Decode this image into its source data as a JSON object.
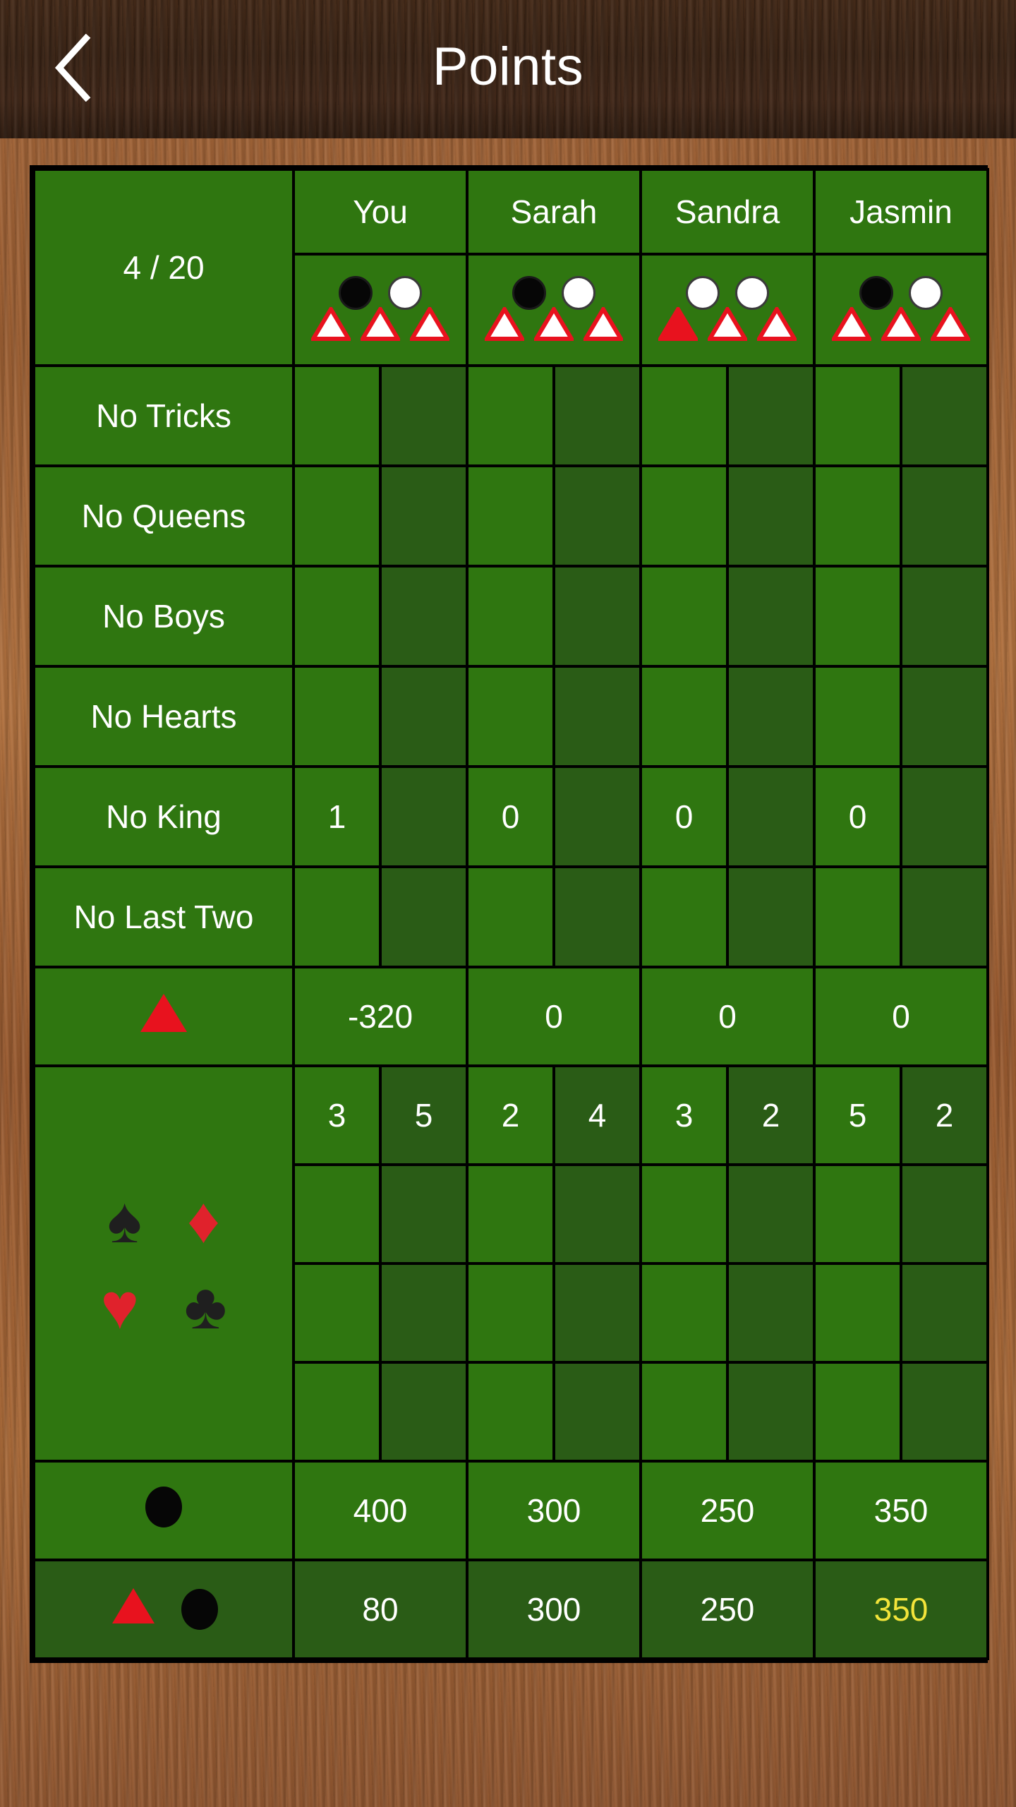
{
  "header": {
    "title": "Points",
    "back_icon": "chevron-left-icon"
  },
  "table": {
    "round_counter": "4 / 20",
    "players": [
      {
        "name": "You",
        "discs": [
          "black",
          "white"
        ],
        "triangles": [
          "outline",
          "outline",
          "outline"
        ]
      },
      {
        "name": "Sarah",
        "discs": [
          "black",
          "white"
        ],
        "triangles": [
          "outline",
          "outline",
          "outline"
        ]
      },
      {
        "name": "Sandra",
        "discs": [
          "white",
          "white"
        ],
        "triangles": [
          "solid",
          "outline",
          "outline"
        ]
      },
      {
        "name": "Jasmin",
        "discs": [
          "black",
          "white"
        ],
        "triangles": [
          "outline",
          "outline",
          "outline"
        ]
      }
    ],
    "contract_rows": [
      {
        "label": "No Tricks",
        "values": [
          "",
          "",
          "",
          ""
        ]
      },
      {
        "label": "No Queens",
        "values": [
          "",
          "",
          "",
          ""
        ]
      },
      {
        "label": "No Boys",
        "values": [
          "",
          "",
          "",
          ""
        ]
      },
      {
        "label": "No Hearts",
        "values": [
          "",
          "",
          "",
          ""
        ]
      },
      {
        "label": "No King",
        "values": [
          "1",
          "0",
          "0",
          "0"
        ]
      },
      {
        "label": "No Last Two",
        "values": [
          "",
          "",
          "",
          ""
        ]
      }
    ],
    "trump_row": {
      "label_icon": "red-triangle-icon",
      "values": [
        "-320",
        "0",
        "0",
        "0"
      ]
    },
    "suit_block": {
      "icons": [
        "spade-icon",
        "diamond-icon",
        "heart-icon",
        "club-icon"
      ],
      "trick_counts": [
        "3",
        "5",
        "2",
        "4",
        "3",
        "2",
        "5",
        "2"
      ],
      "empty_rows": 3
    },
    "black_dot_row": {
      "label_icon": "black-dot-icon",
      "values": [
        "400",
        "300",
        "250",
        "350"
      ]
    },
    "total_row": {
      "label_icons": [
        "red-triangle-icon",
        "black-dot-icon"
      ],
      "values": [
        "80",
        "300",
        "250",
        "350"
      ],
      "highlight_index": 3,
      "highlight_color": "#f2e43a"
    }
  },
  "colors": {
    "cell_light": "#2f7610",
    "cell_dark": "#2a5c16",
    "grid": "#000000",
    "text": "#ffffff",
    "red": "#e0222c",
    "highlight": "#f2e43a",
    "wood_light": "#a3663a",
    "wood_dark": "#3b2415"
  }
}
